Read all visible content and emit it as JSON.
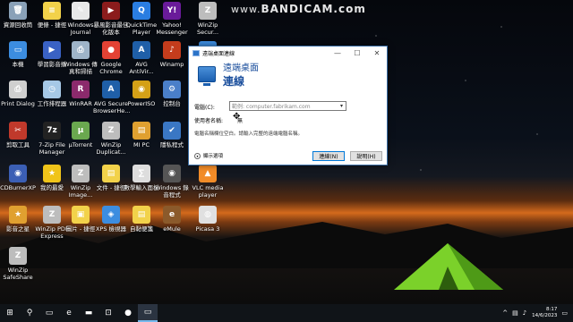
{
  "watermark": {
    "prefix": "www.",
    "text": "BANDICAM.com"
  },
  "desktop_icons": [
    {
      "label": "資源回收筒",
      "color": "#8aa1b8",
      "glyph": "🗑"
    },
    {
      "label": "便條 - 捷徑",
      "color": "#f2d24a",
      "glyph": "≡"
    },
    {
      "label": "Windows Journal",
      "color": "#e8e8e8",
      "glyph": "✎"
    },
    {
      "label": "暴風影音最佳化版本",
      "color": "#8b1c1c",
      "glyph": "▶"
    },
    {
      "label": "QuickTime Player",
      "color": "#2a7de1",
      "glyph": "Q"
    },
    {
      "label": "Yahoo! Messenger",
      "color": "#6a1b9a",
      "glyph": "Y!"
    },
    {
      "label": "WinZip Secur...",
      "color": "#bdbdbd",
      "glyph": "Z"
    },
    {
      "label": "本機",
      "color": "#3c8de0",
      "glyph": "▭"
    },
    {
      "label": "學習影音播",
      "color": "#3a62c4",
      "glyph": "▶"
    },
    {
      "label": "Windows 傳真和掃描",
      "color": "#9fb4c8",
      "glyph": "⎙"
    },
    {
      "label": "Google Chrome",
      "color": "#e34234",
      "glyph": "●"
    },
    {
      "label": "AVG AntiVir...",
      "color": "#1f5fa8",
      "glyph": "A"
    },
    {
      "label": "Winamp",
      "color": "#c43c1c",
      "glyph": "♪"
    },
    {
      "label": "網路",
      "color": "#3c8de0",
      "glyph": "⊞"
    },
    {
      "label": "Print Dialog",
      "color": "#cfcfcf",
      "glyph": "⎙"
    },
    {
      "label": "工作排程器",
      "color": "#a6c8e6",
      "glyph": "◷"
    },
    {
      "label": "WinRAR",
      "color": "#8b2a6c",
      "glyph": "R"
    },
    {
      "label": "AVG Secure BrowserHe...",
      "color": "#1f5fa8",
      "glyph": "A"
    },
    {
      "label": "PowerISO",
      "color": "#d4a017",
      "glyph": "◉"
    },
    {
      "label": "控制台",
      "color": "#4a7fc9",
      "glyph": "⚙"
    },
    {
      "label": "遠端桌面連線",
      "color": "#2b73c8",
      "glyph": "▭"
    },
    {
      "label": "剪取工具",
      "color": "#c0392b",
      "glyph": "✂"
    },
    {
      "label": "7-Zip File Manager",
      "color": "#222222",
      "glyph": "7z"
    },
    {
      "label": "µTorrent",
      "color": "#6aa84f",
      "glyph": "µ"
    },
    {
      "label": "WinZip Duplicat...",
      "color": "#bdbdbd",
      "glyph": "Z"
    },
    {
      "label": "MI PC",
      "color": "#e0a030",
      "glyph": "▤"
    },
    {
      "label": "隱私程式",
      "color": "#3a77c4",
      "glyph": "✔"
    },
    {
      "label": "Website",
      "color": "#2a7de1",
      "glyph": "◎"
    },
    {
      "label": "CDBurnerXP",
      "color": "#3b5fb5",
      "glyph": "◉"
    },
    {
      "label": "我的最愛",
      "color": "#f0c419",
      "glyph": "★"
    },
    {
      "label": "WinZip Image...",
      "color": "#bdbdbd",
      "glyph": "Z"
    },
    {
      "label": "文件 - 捷徑",
      "color": "#f2d24a",
      "glyph": "▤"
    },
    {
      "label": "數學輸入面板",
      "color": "#dddddd",
      "glyph": "∑"
    },
    {
      "label": "Windows 錄音程式",
      "color": "#555555",
      "glyph": "◉"
    },
    {
      "label": "VLC media player",
      "color": "#f28c28",
      "glyph": "▲"
    },
    {
      "label": "影音之星",
      "color": "#e0a030",
      "glyph": "★"
    },
    {
      "label": "WinZip PDF Express",
      "color": "#bdbdbd",
      "glyph": "Z"
    },
    {
      "label": "圖片 - 捷徑",
      "color": "#f2d24a",
      "glyph": "▣"
    },
    {
      "label": "XPS 檢視器",
      "color": "#3c8de0",
      "glyph": "◈"
    },
    {
      "label": "自黏便箋",
      "color": "#f2d24a",
      "glyph": "▤"
    },
    {
      "label": "eMule",
      "color": "#8b5a2b",
      "glyph": "e"
    },
    {
      "label": "Picasa 3",
      "color": "#e0e0e0",
      "glyph": "◍"
    },
    {
      "label": "WinZip SafeShare",
      "color": "#bdbdbd",
      "glyph": "Z"
    }
  ],
  "dialog": {
    "window_title": "遠端桌面連線",
    "header_line1": "遠端桌面",
    "header_line2": "連線",
    "computer_label": "電腦(C):",
    "computer_placeholder": "範例: computer.fabrikam.com",
    "username_label": "使用者名稱:",
    "username_value": "無",
    "hint": "電腦名稱欄位空白。請輸入完整的遠端電腦名稱。",
    "options_label": "顯示選項",
    "connect_button": "連線(N)",
    "help_button": "說明(H)",
    "minimize": "—",
    "maximize": "☐",
    "close": "✕"
  },
  "taskbar": {
    "items": [
      {
        "name": "start-button",
        "glyph": "⊞"
      },
      {
        "name": "search-button",
        "glyph": "⚲"
      },
      {
        "name": "task-view-button",
        "glyph": "▭"
      },
      {
        "name": "edge-button",
        "glyph": "e"
      },
      {
        "name": "file-explorer-button",
        "glyph": "▬"
      },
      {
        "name": "store-button",
        "glyph": "⊡"
      },
      {
        "name": "chrome-button",
        "glyph": "●"
      },
      {
        "name": "remote-desktop-button",
        "glyph": "▭"
      }
    ],
    "time": "8:17",
    "date": "14/6/2023"
  },
  "colors": {
    "accent": "#1a4e9c",
    "taskbar": "#101418",
    "tent": "#7bd12a"
  }
}
